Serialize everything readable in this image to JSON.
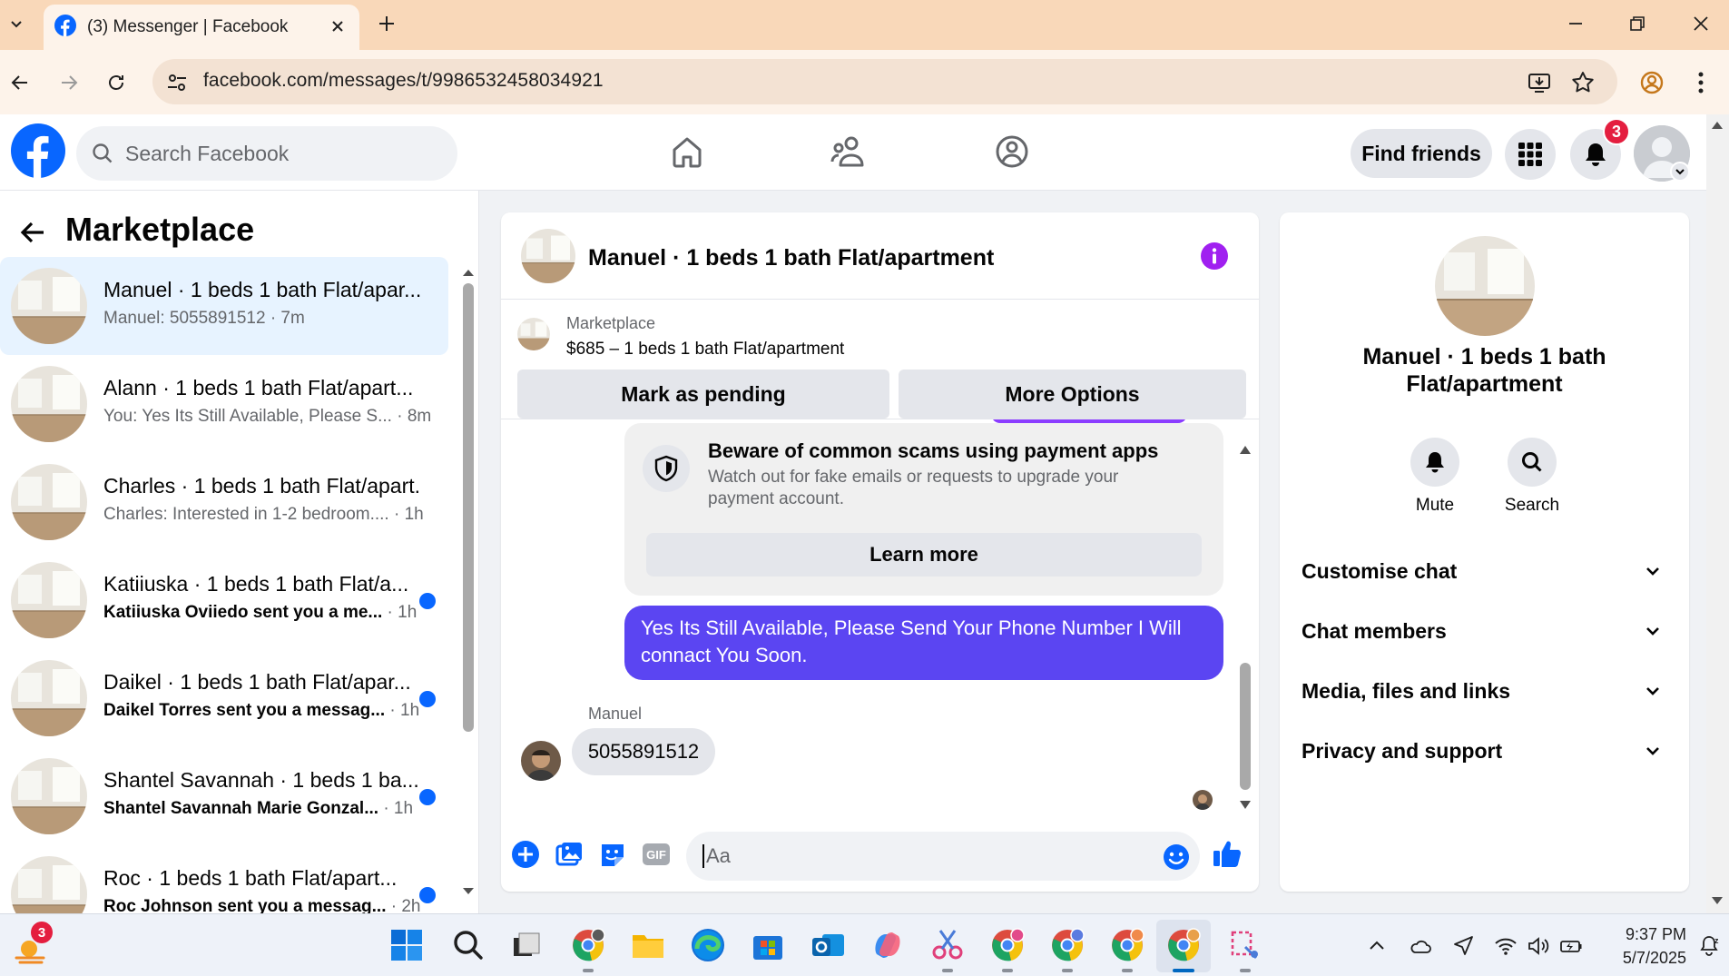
{
  "browser": {
    "tab_title": "(3) Messenger | Facebook",
    "url": "facebook.com/messages/t/9986532458034921"
  },
  "header": {
    "search_placeholder": "Search Facebook",
    "find_friends": "Find friends",
    "notification_count": "3"
  },
  "left_panel": {
    "title": "Marketplace",
    "conversations": [
      {
        "name": "Manuel · 1 beds 1 bath Flat/apar...",
        "preview": "Manuel: 5055891512 · 7m",
        "time": "",
        "unread": false,
        "active": true
      },
      {
        "name": "Alann · 1 beds 1 bath Flat/apart...",
        "preview": "You: Yes Its Still Available, Please S...",
        "time": "· 8m",
        "unread": false,
        "active": false
      },
      {
        "name": "Charles · 1 beds 1 bath Flat/apart...",
        "preview": "Charles: Interested in 1-2 bedroom....",
        "time": "· 1h",
        "unread": false,
        "active": false
      },
      {
        "name": "Katiiuska · 1 beds 1 bath Flat/a...",
        "preview": "Katiiuska Oviiedo sent you a me...",
        "time": "· 1h",
        "unread": true,
        "active": false
      },
      {
        "name": "Daikel · 1 beds 1 bath Flat/apar...",
        "preview": "Daikel Torres sent you a messag...",
        "time": "· 1h",
        "unread": true,
        "active": false
      },
      {
        "name": "Shantel Savannah · 1 beds 1 ba...",
        "preview": "Shantel Savannah Marie Gonzal...",
        "time": "· 1h",
        "unread": true,
        "active": false
      },
      {
        "name": "Roc · 1 beds 1 bath Flat/apart...",
        "preview": "Roc Johnson sent you a messag...",
        "time": "· 2h",
        "unread": true,
        "active": false
      }
    ]
  },
  "chat": {
    "title": "Manuel · 1 beds 1 bath Flat/apartment",
    "marketplace_label": "Marketplace",
    "listing": "$685 – 1 beds 1 bath Flat/apartment",
    "mark_pending": "Mark as pending",
    "more_options": "More Options",
    "scam_title": "Beware of common scams using payment apps",
    "scam_text": "Watch out for fake emails or requests to upgrade your payment account.",
    "learn_more": "Learn more",
    "outgoing_message": "Yes Its Still Available, Please Send Your Phone Number I Will connact You Soon.",
    "sender_name": "Manuel",
    "incoming_message": "5055891512",
    "composer_placeholder": "Aa"
  },
  "info_panel": {
    "name": "Manuel · 1 beds 1 bath Flat/apartment",
    "mute": "Mute",
    "search": "Search",
    "sections": [
      "Customise chat",
      "Chat members",
      "Media, files and links",
      "Privacy and support"
    ]
  },
  "taskbar": {
    "weather_badge": "3",
    "time": "9:37 PM",
    "date": "5/7/2025"
  },
  "colors": {
    "facebook_blue": "#0866ff",
    "outgoing_bubble": "#5b45f2",
    "info_icon": "#a020f0",
    "notification_red": "#e41e3f",
    "tabstrip": "#f9d8b9"
  }
}
